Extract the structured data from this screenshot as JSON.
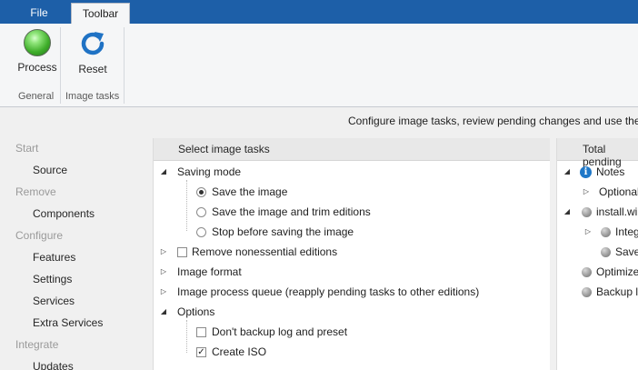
{
  "ribbon": {
    "tabs": [
      {
        "label": "File"
      },
      {
        "label": "Toolbar"
      }
    ],
    "buttons": {
      "process": "Process",
      "reset": "Reset"
    },
    "groups": {
      "general": "General",
      "image_tasks": "Image tasks"
    }
  },
  "description": "Configure image tasks, review pending changes and use the P",
  "nav": {
    "start": "Start",
    "source": "Source",
    "remove": "Remove",
    "components": "Components",
    "configure": "Configure",
    "features": "Features",
    "settings": "Settings",
    "services": "Services",
    "extra_services": "Extra Services",
    "integrate": "Integrate",
    "updates": "Updates"
  },
  "tasks": {
    "header": "Select image tasks",
    "saving_mode": "Saving mode",
    "save_image": "Save the image",
    "save_trim": "Save the image and trim editions",
    "stop_before": "Stop before saving the image",
    "remove_nonessential": "Remove nonessential editions",
    "image_format": "Image format",
    "process_queue": "Image process queue (reapply pending tasks to other editions)",
    "options": "Options",
    "dont_backup": "Don't backup log and preset",
    "create_iso": "Create ISO"
  },
  "pending": {
    "header": "Total pending",
    "notes": "Notes",
    "optionally": "Optionally",
    "install_wim": "install.wim",
    "integ": "Integ",
    "save": "Save",
    "optimize": "Optimize i",
    "backup": "Backup lo"
  },
  "colors": {
    "tab_bar": "#1d5fa8",
    "accent_blue": "#1f78c8",
    "process_green": "#3fae2a"
  }
}
